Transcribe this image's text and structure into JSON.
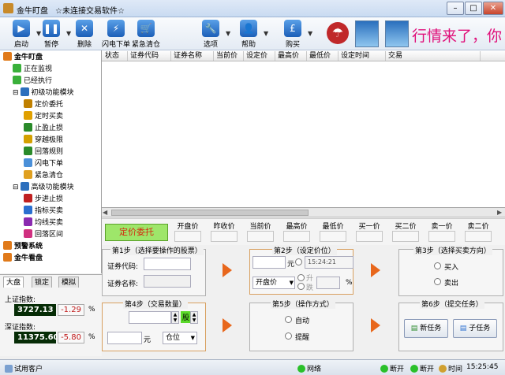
{
  "window": {
    "app_title": "金牛盯盘",
    "status_title": "☆未连接交易软件☆",
    "min_btn": "–",
    "max_btn": "□",
    "close_btn": "✕"
  },
  "marquee": {
    "text": "行情来了，你"
  },
  "toolbar": [
    {
      "label": "启动",
      "icon": "play-icon",
      "glyph": "▶",
      "has_dropdown": true
    },
    {
      "label": "暂停",
      "icon": "pause-icon",
      "glyph": "❚❚",
      "has_dropdown": true
    },
    {
      "label": "删除",
      "icon": "delete-icon",
      "glyph": "✕"
    },
    {
      "label": "闪电下单",
      "icon": "lightning-icon",
      "glyph": "⚡"
    },
    {
      "label": "紧急清仓",
      "icon": "cart-icon",
      "glyph": "🛒"
    },
    {
      "label": "选项",
      "icon": "wrench-icon",
      "glyph": "🔧",
      "has_dropdown": true
    },
    {
      "label": "帮助",
      "icon": "user-help-icon",
      "glyph": "👤",
      "has_dropdown": true
    },
    {
      "label": "购买",
      "icon": "pound-icon",
      "glyph": "£",
      "has_dropdown": true
    }
  ],
  "tree": [
    {
      "label": "金牛盯盘",
      "level": 0,
      "bold": true,
      "icon": "flower-icon",
      "color": "#e07a1a"
    },
    {
      "label": "正在监视",
      "level": 1,
      "icon": "play-icon",
      "color": "#3ab03a"
    },
    {
      "label": "已经执行",
      "level": 1,
      "icon": "check-icon",
      "color": "#3ab03a"
    },
    {
      "label": "初级功能模块",
      "level": 1,
      "icon": "module-icon",
      "color": "#2c6fbd",
      "expander": "⊟"
    },
    {
      "label": "定价委托",
      "level": 2,
      "icon": "yen-icon",
      "color": "#c08000"
    },
    {
      "label": "定时买卖",
      "level": 2,
      "icon": "clock-icon",
      "color": "#e0a000"
    },
    {
      "label": "止盈止损",
      "level": 2,
      "icon": "stop-icon",
      "color": "#2a8a2a"
    },
    {
      "label": "穿越极限",
      "level": 2,
      "icon": "cross-icon",
      "color": "#d4a000"
    },
    {
      "label": "回落规则",
      "level": 2,
      "icon": "fall-icon",
      "color": "#2a8a2a"
    },
    {
      "label": "闪电下单",
      "level": 2,
      "icon": "lightning-icon",
      "color": "#4a90d9"
    },
    {
      "label": "紧急清仓",
      "level": 2,
      "icon": "crown-icon",
      "color": "#e0a020"
    },
    {
      "label": "高级功能模块",
      "level": 1,
      "icon": "module-icon",
      "color": "#2c6fbd",
      "expander": "⊟"
    },
    {
      "label": "步进止损",
      "level": 2,
      "icon": "step-icon",
      "color": "#c02020"
    },
    {
      "label": "指标买卖",
      "level": 2,
      "icon": "indicator-icon",
      "color": "#2a6fd0"
    },
    {
      "label": "均线买卖",
      "level": 2,
      "icon": "ma-icon",
      "color": "#8a2ab0"
    },
    {
      "label": "回落区间",
      "level": 2,
      "icon": "range-icon",
      "color": "#d03080"
    },
    {
      "label": "预警系统",
      "level": 0,
      "bold": true,
      "icon": "flower-icon",
      "color": "#e07a1a"
    },
    {
      "label": "金牛看盘",
      "level": 0,
      "bold": true,
      "icon": "flower-icon",
      "color": "#e07a1a"
    }
  ],
  "grid_columns": [
    "状态",
    "证券代码",
    "证券名称",
    "当前价",
    "设定价",
    "最高价",
    "最低价",
    "设定时间",
    "交易"
  ],
  "quote": {
    "function_label": "定价委托",
    "fields": [
      "开盘价",
      "昨收价",
      "当前价",
      "最高价",
      "最低价",
      "买一价",
      "买二价",
      "卖一价",
      "卖二价"
    ]
  },
  "step1": {
    "title": "第1步（选择要操作的股票）",
    "code_label": "证券代码:",
    "name_label": "证券名称:"
  },
  "step2": {
    "title": "第2步（设定价位）",
    "unit": "元",
    "time_value": "15:24:21",
    "price_type": "开盘价",
    "rise": "升",
    "fall": "跌",
    "percent": "%"
  },
  "step3": {
    "title": "第3步（选择买卖方向）",
    "buy": "买入",
    "sell": "卖出"
  },
  "step4": {
    "title": "第4步（交易数量）",
    "unit_shares": "股",
    "unit_yuan": "元",
    "position_select": "仓位"
  },
  "step5": {
    "title": "第5步（操作方式）",
    "auto": "自动",
    "remind": "提醒"
  },
  "step6": {
    "title": "第6步（提交任务）",
    "new_task": "新任务",
    "sub_task": "子任务"
  },
  "left_tabs": [
    "大盘",
    "锁定",
    "模拟"
  ],
  "indices": [
    {
      "label": "上证指数:",
      "value": "3727.13",
      "change": "-1.29",
      "unit": "%"
    },
    {
      "label": "深证指数:",
      "value": "11375.60",
      "change": "-5.80",
      "unit": "%"
    }
  ],
  "status": {
    "client": "试用客户",
    "network": "网络",
    "disconnect1": "断开",
    "disconnect2": "断开",
    "time_label": "时间",
    "time": "15:25:45"
  }
}
